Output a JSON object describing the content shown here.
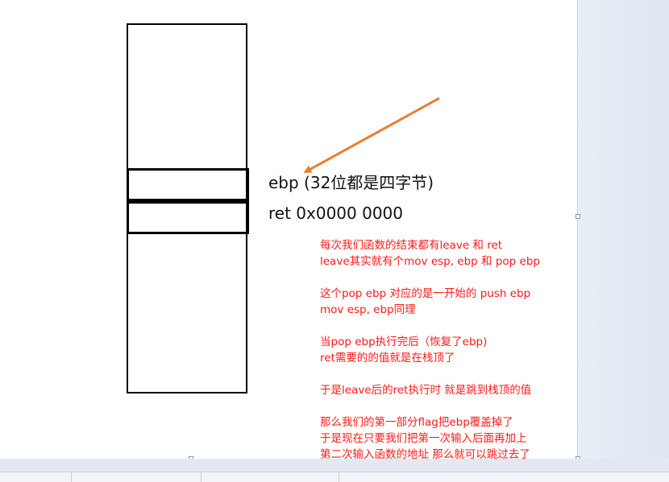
{
  "diagram": {
    "label_ebp": "ebp (32位都是四字节)",
    "label_ret": "ret 0x0000 0000",
    "arrow_color": "#ed7d31",
    "note_color": "#ff1a1a",
    "notes": [
      [
        "每次我们函数的结束都有leave 和 ret",
        "leave其实就有个mov esp, ebp 和 pop ebp"
      ],
      [
        "这个pop ebp 对应的是一开始的 push ebp",
        "mov esp, ebp同理"
      ],
      [
        "当pop ebp执行完后（恢复了ebp)",
        "ret需要的的值就是在栈顶了"
      ],
      [
        "于是leave后的ret执行时 就是跳到栈顶的值"
      ],
      [
        "那么我们的第一部分flag把ebp覆盖掉了",
        "于是现在只要我们把第一次输入后面再加上",
        "第二次输入函数的地址 那么就可以跳过去了"
      ]
    ]
  }
}
